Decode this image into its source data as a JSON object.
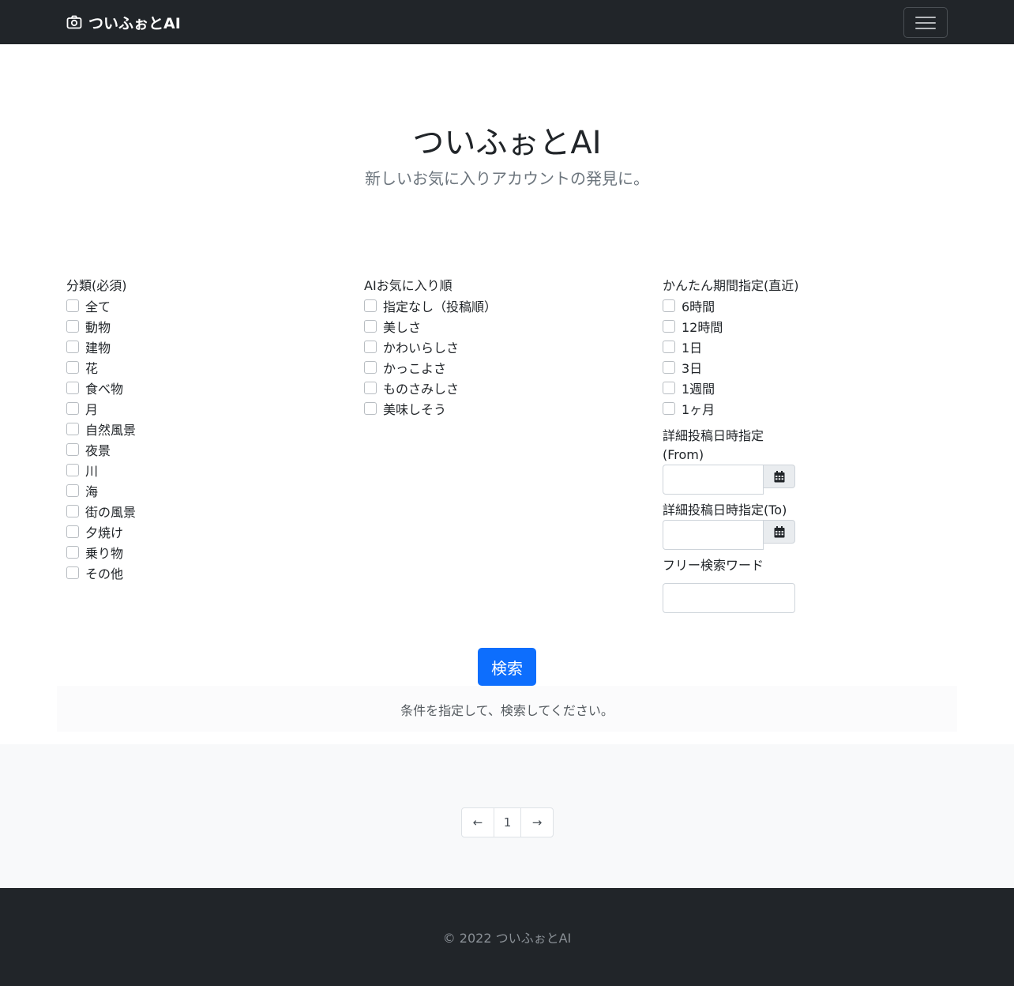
{
  "navbar": {
    "brand": "ついふぉとAI",
    "brand_icon": "camera-icon",
    "toggler_icon": "hamburger-icon"
  },
  "hero": {
    "title": "ついふぉとAI",
    "subtitle": "新しいお気に入りアカウントの発見に。"
  },
  "category": {
    "label": "分類(必須)",
    "options": [
      "全て",
      "動物",
      "建物",
      "花",
      "食べ物",
      "月",
      "自然風景",
      "夜景",
      "川",
      "海",
      "街の風景",
      "夕焼け",
      "乗り物",
      "その他"
    ]
  },
  "ai_order": {
    "label": "AIお気に入り順",
    "options": [
      "指定なし（投稿順）",
      "美しさ",
      "かわいらしさ",
      "かっこよさ",
      "ものさみしさ",
      "美味しそう"
    ]
  },
  "period": {
    "label": "かんたん期間指定(直近)",
    "options": [
      "6時間",
      "12時間",
      "1日",
      "3日",
      "1週間",
      "1ヶ月"
    ]
  },
  "detail_from": {
    "label": "詳細投稿日時指定(From)",
    "value": "",
    "icon": "calendar-icon"
  },
  "detail_to": {
    "label": "詳細投稿日時指定(To)",
    "value": "",
    "icon": "calendar-icon"
  },
  "free_word": {
    "label": "フリー検索ワード",
    "value": ""
  },
  "search_button": "検索",
  "hint": "条件を指定して、検索してください。",
  "pagination": {
    "prev": "←",
    "page": "1",
    "next": "→"
  },
  "footer": {
    "copyright": "© 2022 ついふぉとAI"
  },
  "colors": {
    "navbar_bg": "#212529",
    "primary": "#0d6efd",
    "muted": "#6c757d",
    "light_bg": "#f8f9fa"
  }
}
